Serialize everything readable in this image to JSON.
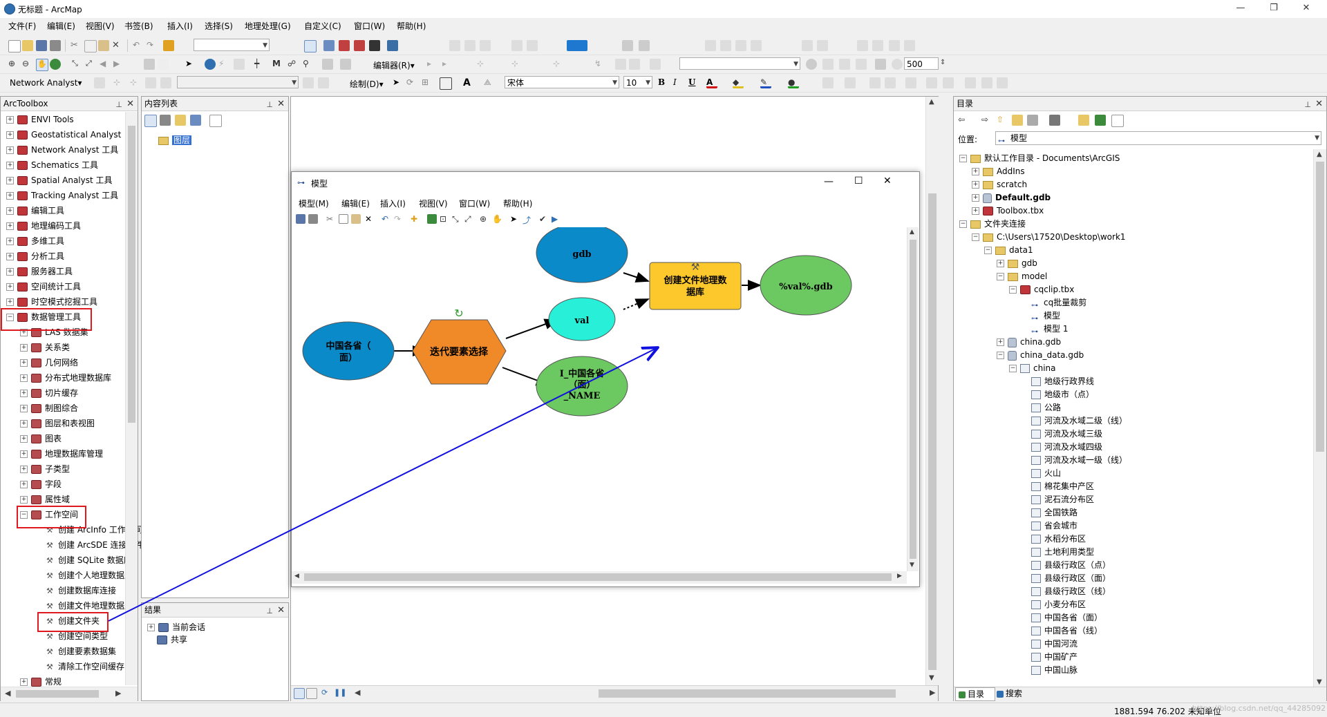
{
  "title": {
    "doc": "无标题",
    "sep": " - ",
    "app": "ArcMap"
  },
  "menus": [
    "文件(F)",
    "编辑(E)",
    "视图(V)",
    "书签(B)",
    "插入(I)",
    "选择(S)",
    "地理处理(G)",
    "自定义(C)",
    "窗口(W)",
    "帮助(H)"
  ],
  "toolbar": {
    "editor_label": "编辑器(R)▾",
    "scale_value": "500",
    "network_label": "Network Analyst▾",
    "draw_label": "绘制(D)▾",
    "font_name": "宋体",
    "font_size": "10",
    "bold": "B",
    "italic": "I",
    "underline": "U",
    "fontcolor": "A"
  },
  "arctoolbox": {
    "title": "ArcToolbox",
    "top_items": [
      "ENVI Tools",
      "Geostatistical Analyst",
      "Network Analyst 工具",
      "Schematics 工具",
      "Spatial Analyst 工具",
      "Tracking Analyst 工具",
      "编辑工具",
      "地理编码工具",
      "多维工具",
      "分析工具",
      "服务器工具",
      "空间统计工具",
      "时空模式挖掘工具",
      "数据管理工具"
    ],
    "sub_items": [
      "LAS 数据集",
      "关系类",
      "几何网络",
      "分布式地理数据库",
      "切片缓存",
      "制图综合",
      "图层和表视图",
      "图表",
      "地理数据库管理",
      "子类型",
      "字段",
      "属性域",
      "工作空间"
    ],
    "tools": [
      "创建 ArcInfo 工作空间",
      "创建 ArcSDE 连接文件",
      "创建 SQLite 数据库",
      "创建个人地理数据库",
      "创建数据库连接",
      "创建文件地理数据库",
      "创建文件夹",
      "创建空间类型",
      "创建要素数据集",
      "清除工作空间缓存"
    ],
    "last_item": "常规"
  },
  "toc": {
    "title": "内容列表",
    "layer": "图层"
  },
  "results": {
    "title": "结果",
    "items": [
      "当前会话",
      "共享"
    ]
  },
  "model": {
    "title": "模型",
    "menus": [
      "模型(M)",
      "编辑(E)",
      "插入(I)",
      "视图(V)",
      "窗口(W)",
      "帮助(H)"
    ],
    "nodes": {
      "gdb": "gdb",
      "val": "val",
      "create": [
        "创建文件地理数",
        "据库"
      ],
      "outgdb": "%val%.gdb",
      "input": [
        "中国各省（",
        "面）"
      ],
      "iterate": "迭代要素选择",
      "iout": [
        "I_中国各省",
        "（面）",
        "_NAME"
      ]
    }
  },
  "catalog": {
    "title": "目录",
    "location_label": "位置:",
    "location_value": "模型",
    "home": "默认工作目录 - Documents\\ArcGIS",
    "home_items": [
      "AddIns",
      "scratch",
      "Default.gdb",
      "Toolbox.tbx"
    ],
    "folder_conn": "文件夹连接",
    "path": "C:\\Users\\17520\\Desktop\\work1",
    "data1": "data1",
    "gdb": "gdb",
    "model": "model",
    "tbx": "cqclip.tbx",
    "tbx_items": [
      "cq批量裁剪",
      "模型",
      "模型 1"
    ],
    "china_gdb": "china.gdb",
    "china_data_gdb": "china_data.gdb",
    "china": "china",
    "layers": [
      "地级行政界线",
      "地级市（点）",
      "公路",
      "河流及水域二级（线）",
      "河流及水域三级",
      "河流及水域四级",
      "河流及水域一级（线）",
      "火山",
      "棉花集中产区",
      "泥石流分布区",
      "全国铁路",
      "省会城市",
      "水稻分布区",
      "土地利用类型",
      "县级行政区（点）",
      "县级行政区（面）",
      "县级行政区（线）",
      "小麦分布区",
      "中国各省（面）",
      "中国各省（线）",
      "中国河流",
      "中国矿产",
      "中国山脉"
    ],
    "tabs": [
      "目录",
      "搜索"
    ]
  },
  "status": {
    "coords": "1881.594  76.202 未知单位",
    "watermark": "https://blog.csdn.net/qq_44285092"
  }
}
